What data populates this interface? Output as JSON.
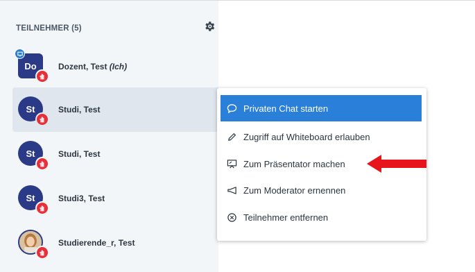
{
  "participants": {
    "header": "TEILNEHMER (5)",
    "gear_icon": "gear-icon",
    "list": [
      {
        "initials": "Do",
        "name": "Dozent, Test",
        "suffix": "(Ich)"
      },
      {
        "initials": "St",
        "name": "Studi, Test",
        "suffix": ""
      },
      {
        "initials": "St",
        "name": "Studi, Test",
        "suffix": ""
      },
      {
        "initials": "St",
        "name": "Studi3, Test",
        "suffix": ""
      },
      {
        "initials": "",
        "name": "Studierende_r, Test",
        "suffix": ""
      }
    ]
  },
  "context_menu": {
    "items": [
      {
        "label": "Privaten Chat starten",
        "icon": "chat-bubble-icon"
      },
      {
        "label": "Zugriff auf Whiteboard erlauben",
        "icon": "pencil-icon"
      },
      {
        "label": "Zum Präsentator machen",
        "icon": "presentation-icon"
      },
      {
        "label": "Zum Moderator ernennen",
        "icon": "megaphone-icon"
      },
      {
        "label": "Teilnehmer entfernen",
        "icon": "remove-circle-icon"
      }
    ]
  },
  "colors": {
    "avatar": "#2a3a87",
    "hand_badge": "#e5303a",
    "menu_active": "#2a7fd8",
    "annotation_arrow": "#e8141b"
  }
}
